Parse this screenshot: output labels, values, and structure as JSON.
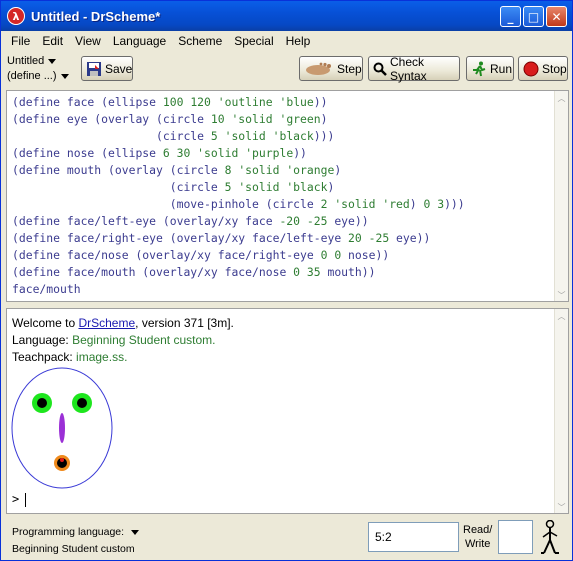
{
  "window": {
    "title": "Untitled - DrScheme*",
    "minimize_label": "_",
    "maximize_label": "□",
    "close_label": "✕"
  },
  "menu": [
    "File",
    "Edit",
    "View",
    "Language",
    "Scheme",
    "Special",
    "Help"
  ],
  "toolbar": {
    "file_label": "Untitled",
    "define_label": "(define ...)",
    "save_label": "Save",
    "step_label": "Step",
    "check_syntax_label": "Check Syntax",
    "run_label": "Run",
    "stop_label": "Stop"
  },
  "editor": {
    "lines": [
      "(define face (ellipse 100 120 'outline 'blue))",
      "(define eye (overlay (circle 10 'solid 'green)",
      "                     (circle 5 'solid 'black)))",
      "(define nose (ellipse 6 30 'solid 'purple))",
      "(define mouth (overlay (circle 8 'solid 'orange)",
      "                       (circle 5 'solid 'black)",
      "                       (move-pinhole (circle 2 'solid 'red) 0 3)))",
      "(define face/left-eye (overlay/xy face -20 -25 eye))",
      "(define face/right-eye (overlay/xy face/left-eye 20 -25 eye))",
      "(define face/nose (overlay/xy face/right-eye 0 0 nose))",
      "(define face/mouth (overlay/xy face/nose 0 35 mouth))",
      "face/mouth"
    ]
  },
  "interactions": {
    "welcome_prefix": "Welcome to ",
    "welcome_link": "DrScheme",
    "welcome_suffix": ", version 371 [3m].",
    "language_prefix": "Language: ",
    "language_value": "Beginning Student custom.",
    "teachpack_prefix": "Teachpack: ",
    "teachpack_value": "image.ss.",
    "prompt": ">"
  },
  "status": {
    "programming_language_label": "Programming language:",
    "language_name": "Beginning Student custom",
    "position": "5:2",
    "read_label": "Read/",
    "write_label": "Write"
  },
  "colors": {
    "face_outline": "#3a3ad6",
    "eye_outer": "#1ee61e",
    "eye_inner": "#000000",
    "nose": "#9b30d6",
    "mouth_outer": "#f08a1c",
    "mouth_inner": "#000000",
    "mouth_dot": "#e01818"
  }
}
